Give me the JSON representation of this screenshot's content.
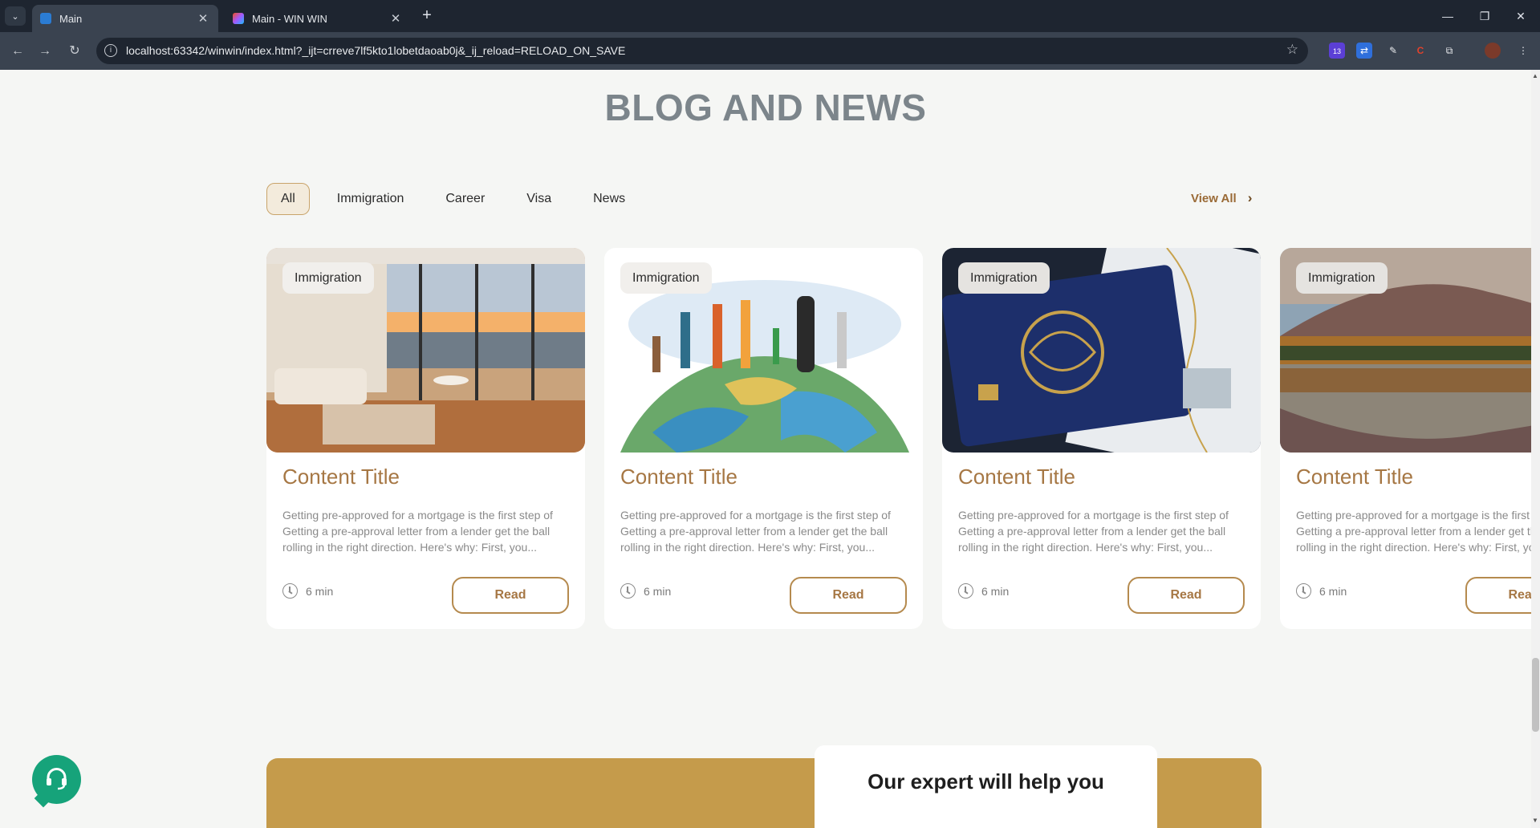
{
  "browser": {
    "tabs": [
      {
        "title": "Main",
        "active": true,
        "favicon": "webstorm-icon"
      },
      {
        "title": "Main - WIN WIN",
        "active": false,
        "favicon": "figma-icon"
      }
    ],
    "url": "localhost:63342/winwin/index.html?_ijt=crreve7lf5kto1lobetdaoab0j&_ij_reload=RELOAD_ON_SAVE",
    "extension_badge": "13"
  },
  "section": {
    "title": "BLOG AND NEWS",
    "filters": [
      "All",
      "Immigration",
      "Career",
      "Visa",
      "News"
    ],
    "selected_filter": "All",
    "view_all": "View All"
  },
  "cards": [
    {
      "tag": "Immigration",
      "title": "Content Title",
      "description": "Getting pre-approved for a mortgage is the first step of Getting a pre-approval letter from a lender get the ball rolling in the right direction. Here's why: First, you...",
      "time": "6 min",
      "button": "Read",
      "image": "apartment-window-sunset"
    },
    {
      "tag": "Immigration",
      "title": "Content Title",
      "description": "Getting pre-approved for a mortgage is the first step of Getting a pre-approval letter from a lender get the ball rolling in the right direction. Here's why: First, you...",
      "time": "6 min",
      "button": "Read",
      "image": "people-walking-on-globe"
    },
    {
      "tag": "Immigration",
      "title": "Content Title",
      "description": "Getting pre-approved for a mortgage is the first step of Getting a pre-approval letter from a lender get the ball rolling in the right direction. Here's why: First, you...",
      "time": "6 min",
      "button": "Read",
      "image": "uae-passport"
    },
    {
      "tag": "Immigration",
      "title": "Content Title",
      "description": "Getting pre-approved for a mortgage is the first step of Getting a pre-approval letter from a lender get the ball rolling in the right direction. Here's why: First, you...",
      "time": "6 min",
      "button": "Read",
      "image": "mountain-lake-forest"
    }
  ],
  "cta": {
    "title": "Our expert will help you"
  },
  "colors": {
    "accent": "#a67744",
    "band": "#c59b4b",
    "support": "#16a37a"
  }
}
